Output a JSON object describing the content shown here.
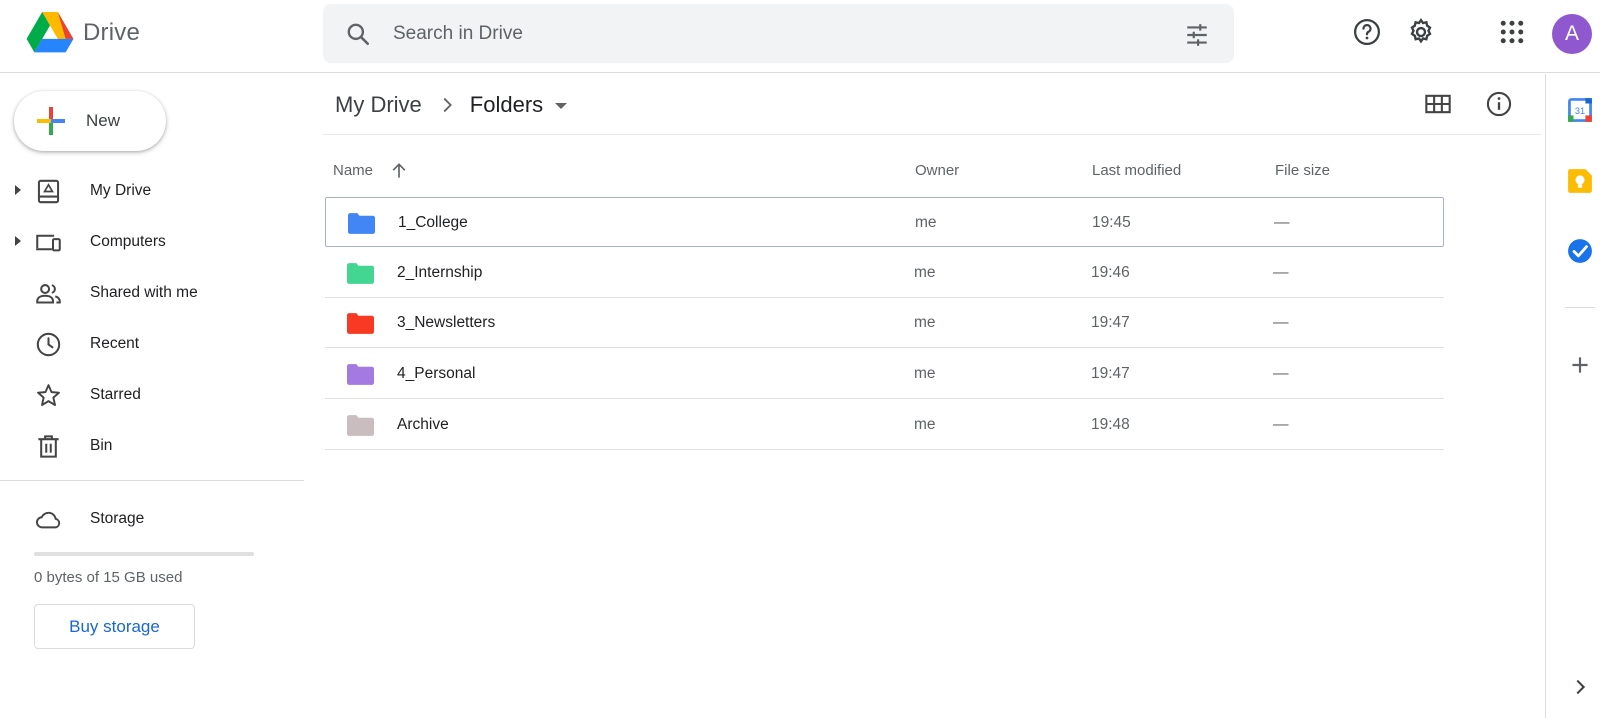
{
  "app": {
    "name": "Drive"
  },
  "search": {
    "placeholder": "Search in Drive"
  },
  "header": {
    "avatar_initial": "A"
  },
  "sidebar": {
    "new_label": "New",
    "items": [
      {
        "label": "My Drive",
        "icon": "my-drive-icon",
        "expandable": true
      },
      {
        "label": "Computers",
        "icon": "computers-icon",
        "expandable": true
      },
      {
        "label": "Shared with me",
        "icon": "shared-icon",
        "expandable": false
      },
      {
        "label": "Recent",
        "icon": "clock-icon",
        "expandable": false
      },
      {
        "label": "Starred",
        "icon": "star-icon",
        "expandable": false
      },
      {
        "label": "Bin",
        "icon": "trash-icon",
        "expandable": false
      }
    ],
    "storage": {
      "label": "Storage",
      "used_text": "0 bytes of 15 GB used",
      "used_fraction": 0,
      "buy_label": "Buy storage"
    }
  },
  "breadcrumb": {
    "root": "My Drive",
    "current": "Folders"
  },
  "table": {
    "columns": {
      "name": "Name",
      "owner": "Owner",
      "modified": "Last modified",
      "size": "File size"
    },
    "rows": [
      {
        "name": "1_College",
        "owner": "me",
        "modified": "19:45",
        "size": "—",
        "color": "#4285f4",
        "selected": true
      },
      {
        "name": "2_Internship",
        "owner": "me",
        "modified": "19:46",
        "size": "—",
        "color": "#42d692"
      },
      {
        "name": "3_Newsletters",
        "owner": "me",
        "modified": "19:47",
        "size": "—",
        "color": "#f83a22"
      },
      {
        "name": "4_Personal",
        "owner": "me",
        "modified": "19:47",
        "size": "—",
        "color": "#a479e2"
      },
      {
        "name": "Archive",
        "owner": "me",
        "modified": "19:48",
        "size": "—",
        "color": "#cabdbf"
      }
    ]
  },
  "rail": {
    "calendar_date": "31"
  },
  "colors": {
    "accent": "#1a73e8",
    "avatar": "#9058cf",
    "search_bg": "#f1f3f4"
  }
}
